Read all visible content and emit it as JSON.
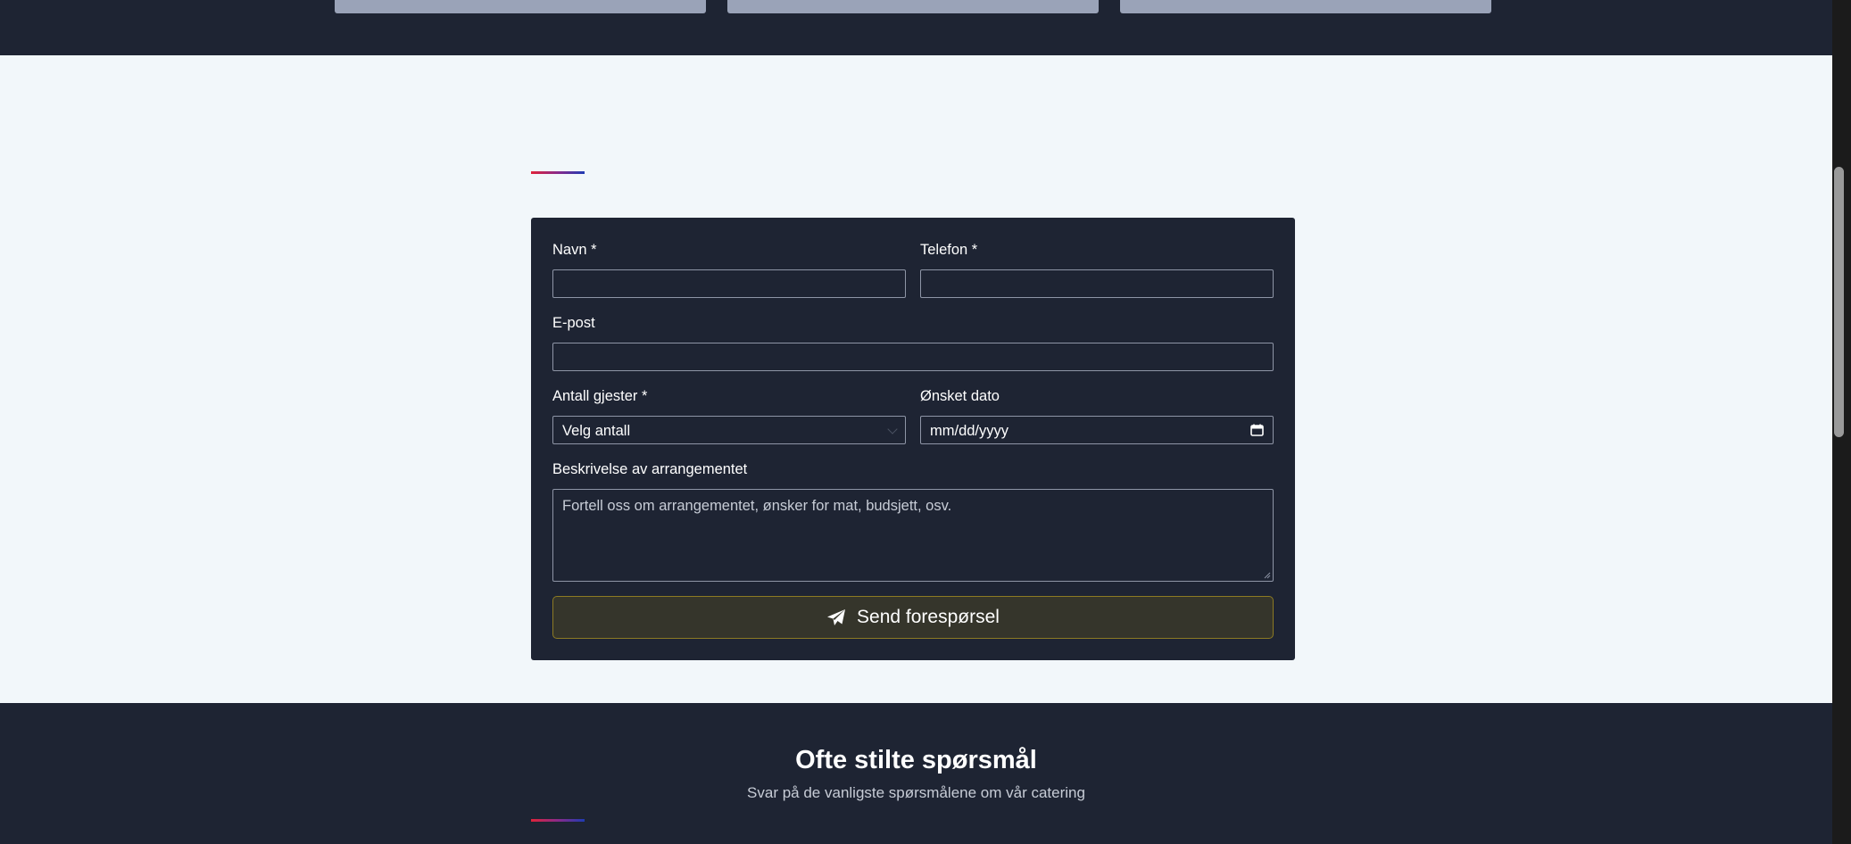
{
  "form": {
    "name_label": "Navn *",
    "phone_label": "Telefon *",
    "email_label": "E-post",
    "guests_label": "Antall gjester *",
    "guests_selected": "Velg antall",
    "date_label": "Ønsket dato",
    "date_placeholder": "mm/dd/yyyy",
    "description_label": "Beskrivelse av arrangementet",
    "description_placeholder": "Fortell oss om arrangementet, ønsker for mat, budsjett, osv.",
    "submit_label": "Send forespørsel",
    "submit_icon": "paper-plane-icon"
  },
  "faq": {
    "title": "Ofte stilte spørsmål",
    "subtitle": "Svar på de vanligste spørsmålene om vår catering"
  },
  "colors": {
    "dark_bg": "#1e2433",
    "light_bg": "#f2f7fa",
    "accent_gold": "#8c7a23",
    "accent_red": "#e02339",
    "accent_blue": "#1f3bb3"
  }
}
